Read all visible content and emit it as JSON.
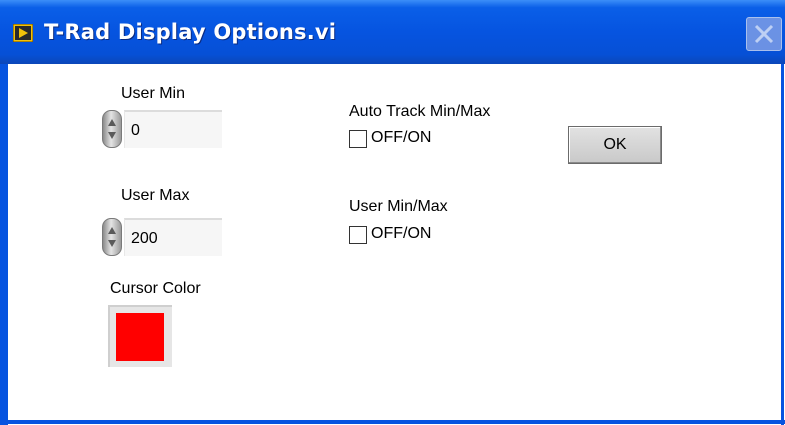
{
  "window": {
    "title": "T-Rad Display Options.vi",
    "close_icon": "close-icon",
    "app_icon": "labview-vi-icon"
  },
  "controls": {
    "user_min": {
      "label": "User Min",
      "value": "0"
    },
    "user_max": {
      "label": "User Max",
      "value": "200"
    },
    "cursor_color": {
      "label": "Cursor Color",
      "color": "#ff0000"
    },
    "auto_track": {
      "label": "Auto Track Min/Max",
      "toggle_label": "OFF/ON",
      "checked": false
    },
    "user_minmax": {
      "label": "User Min/Max",
      "toggle_label": "OFF/ON",
      "checked": false
    },
    "ok_button": {
      "label": "OK"
    }
  },
  "colors": {
    "titlebar": "#0654e0",
    "cursor": "#ff0000"
  }
}
